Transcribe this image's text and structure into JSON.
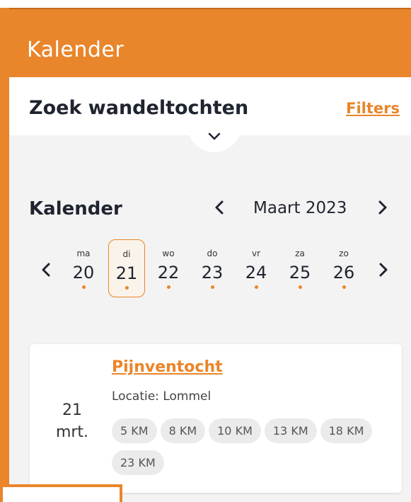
{
  "header": {
    "title": "Kalender"
  },
  "search": {
    "title": "Zoek wandeltochten",
    "filters_label": "Filters"
  },
  "calendar": {
    "title": "Kalender",
    "month_label": "Maart 2023",
    "days": [
      {
        "name": "ma",
        "num": "20"
      },
      {
        "name": "di",
        "num": "21"
      },
      {
        "name": "wo",
        "num": "22"
      },
      {
        "name": "do",
        "num": "23"
      },
      {
        "name": "vr",
        "num": "24"
      },
      {
        "name": "za",
        "num": "25"
      },
      {
        "name": "zo",
        "num": "26"
      }
    ],
    "selected_day": "21"
  },
  "event": {
    "day": "21",
    "month": "mrt.",
    "title": "Pijnventocht",
    "location": "Locatie: Lommel",
    "distances": [
      "5 KM",
      "8 KM",
      "10 KM",
      "13 KM",
      "18 KM",
      "23 KM"
    ]
  },
  "colors": {
    "accent": "#e9852a",
    "background": "#f3f3f3"
  }
}
